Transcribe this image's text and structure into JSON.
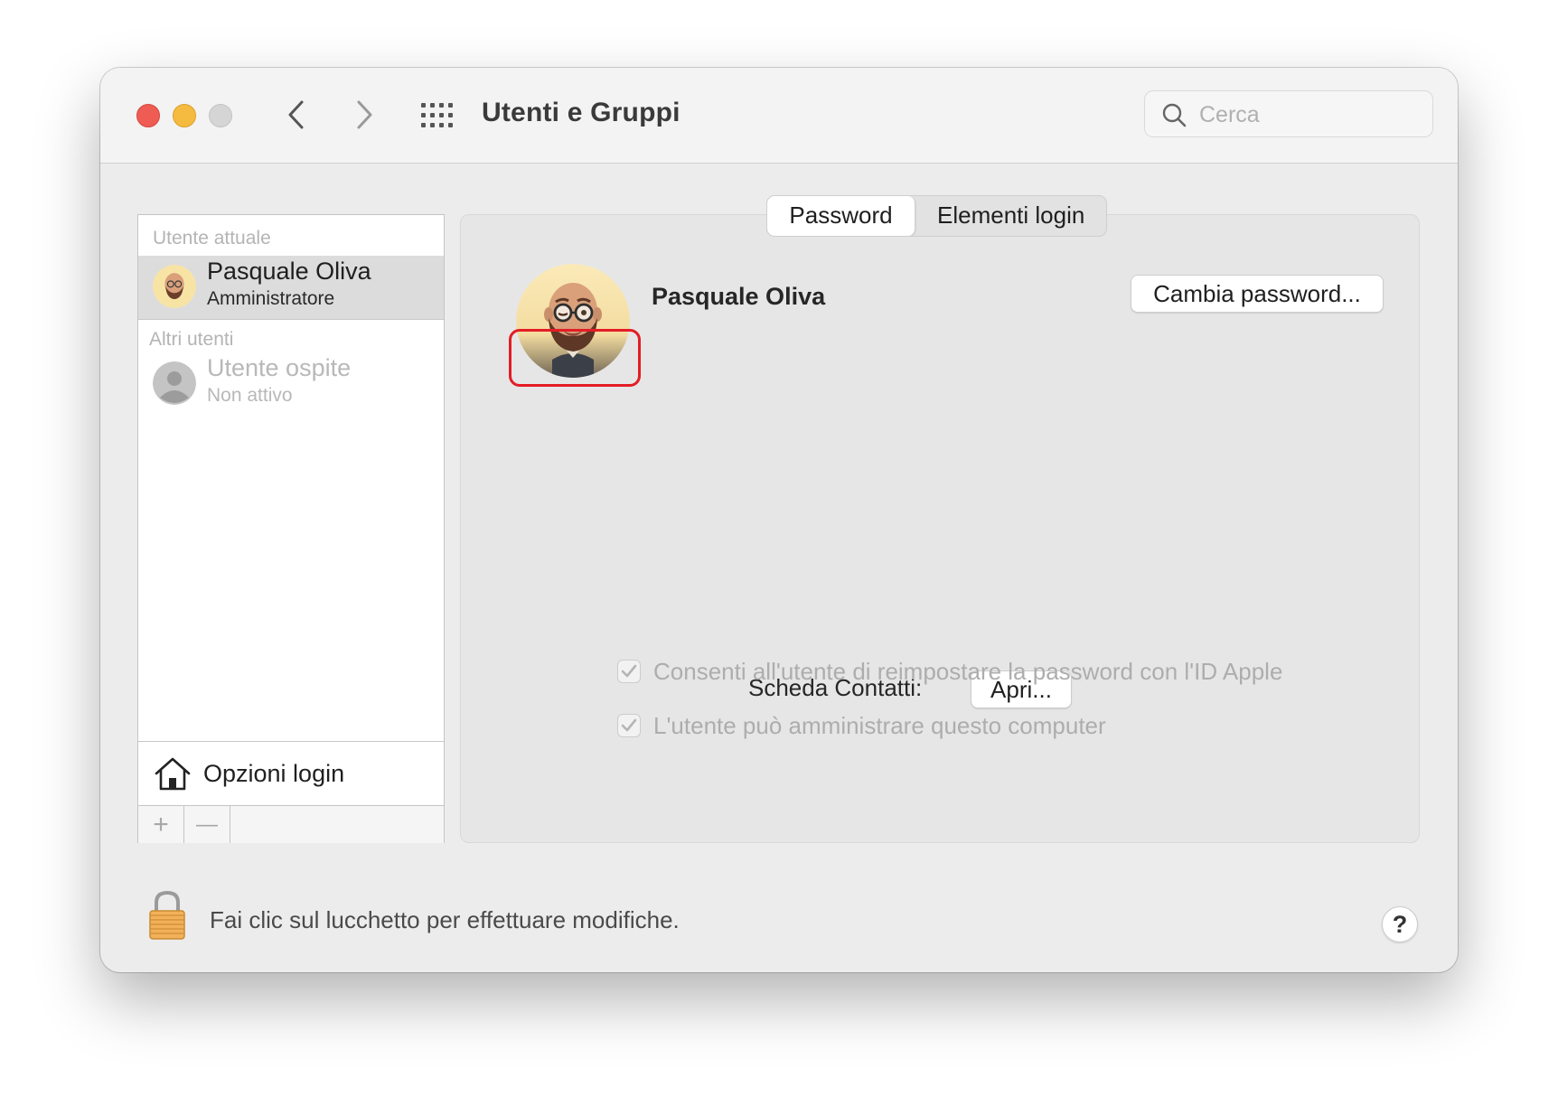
{
  "window": {
    "title": "Utenti e Gruppi"
  },
  "toolbar": {
    "back_icon": "chevron-left-icon",
    "forward_icon": "chevron-right-icon",
    "grid_icon": "show-all-grid-icon"
  },
  "search": {
    "placeholder": "Cerca",
    "value": ""
  },
  "sidebar": {
    "current_section": "Utente attuale",
    "current_user": {
      "name": "Pasquale Oliva",
      "role": "Amministratore"
    },
    "others_section": "Altri utenti",
    "other_users": [
      {
        "name": "Utente ospite",
        "role": "Non attivo"
      }
    ],
    "login_options": "Opzioni login",
    "add_label": "+",
    "remove_label": "—"
  },
  "tabs": [
    {
      "label": "Password",
      "active": true
    },
    {
      "label": "Elementi login",
      "active": false
    }
  ],
  "main": {
    "user_name": "Pasquale Oliva",
    "change_password": "Cambia password...",
    "contacts_label": "Scheda Contatti:",
    "open_button": "Apri...",
    "checkboxes": [
      {
        "label": "Consenti all'utente di reimpostare la password con l'ID Apple",
        "checked": true,
        "enabled": false
      },
      {
        "label": "L'utente può amministrare questo computer",
        "checked": true,
        "enabled": false
      }
    ]
  },
  "footer": {
    "lock_text": "Fai clic sul lucchetto per effettuare modifiche.",
    "help_label": "?"
  },
  "colors": {
    "close": "#ee5c54",
    "minimize": "#f5bb40",
    "zoom_disabled": "#d5d5d5",
    "annotation_highlight": "#e31d25",
    "selected_row": "#dcdcdc"
  }
}
